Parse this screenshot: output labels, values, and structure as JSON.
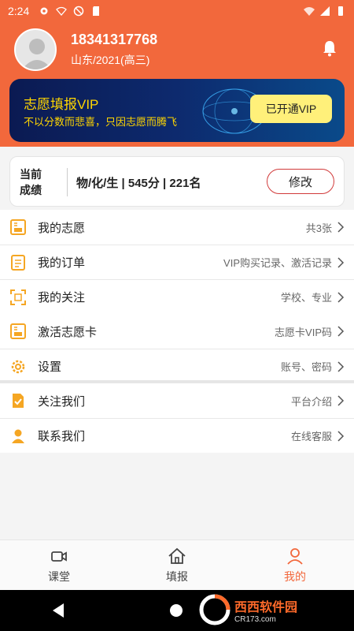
{
  "status_bar": {
    "time": "2:24"
  },
  "profile": {
    "phone": "18341317768",
    "region": "山东/2021(高三)"
  },
  "vip": {
    "title": "志愿填报VIP",
    "subtitle": "不以分数而悲喜，只因志愿而腾飞",
    "button": "已开通VIP"
  },
  "score": {
    "label": "当前\n成绩",
    "label_line1": "当前",
    "label_line2": "成绩",
    "value": "物/化/生 | 545分 | 221名",
    "edit": "修改"
  },
  "menu_group1": [
    {
      "label": "我的志愿",
      "right": "共3张",
      "icon": "card-icon"
    },
    {
      "label": "我的订单",
      "right": "VIP购买记录、激活记录",
      "icon": "order-icon"
    },
    {
      "label": "我的关注",
      "right": "学校、专业",
      "icon": "focus-icon"
    }
  ],
  "menu_group2": [
    {
      "label": "激活志愿卡",
      "right": "志愿卡VIP码",
      "icon": "card-icon"
    },
    {
      "label": "设置",
      "right": "账号、密码",
      "icon": "gear-icon"
    }
  ],
  "menu_group3": [
    {
      "label": "关注我们",
      "right": "平台介绍",
      "icon": "doc-check-icon"
    },
    {
      "label": "联系我们",
      "right": "在线客服",
      "icon": "person-icon"
    }
  ],
  "bottom_nav": [
    {
      "label": "课堂",
      "icon": "video-icon"
    },
    {
      "label": "填报",
      "icon": "home-icon"
    },
    {
      "label": "我的",
      "icon": "user-icon"
    }
  ],
  "watermark": {
    "name": "西西软件园",
    "url": "CR173.com"
  },
  "colors": {
    "accent": "#f2683c",
    "icon": "#f5a623",
    "vip_text": "#ffd600"
  }
}
